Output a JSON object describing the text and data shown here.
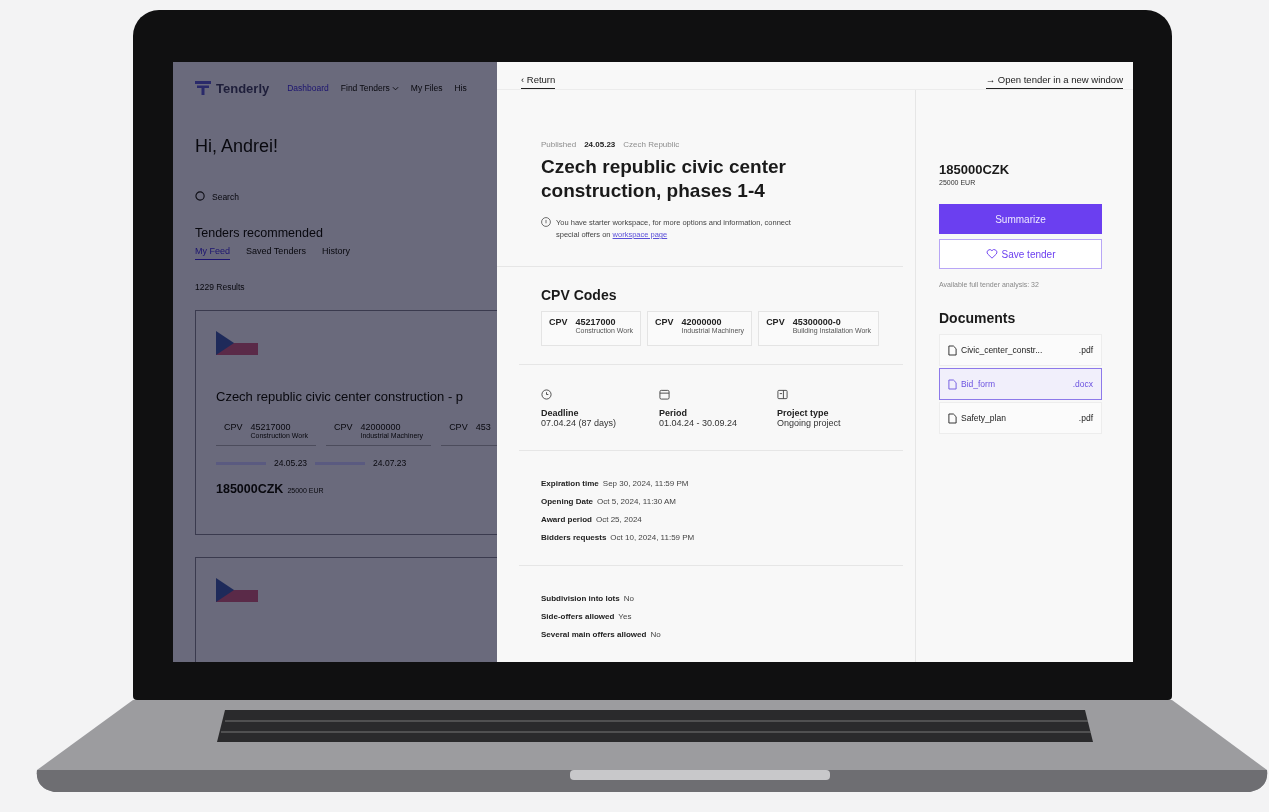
{
  "dashboard": {
    "brand": "Tenderly",
    "nav": [
      {
        "label": "Dashboard",
        "selected": true,
        "has_menu": false
      },
      {
        "label": "Find Tenders",
        "selected": false,
        "has_menu": true
      },
      {
        "label": "My Files",
        "selected": false,
        "has_menu": false
      },
      {
        "label": "His",
        "selected": false,
        "has_menu": false
      }
    ],
    "greeting": "Hi, Andrei!",
    "search": {
      "placeholder": "Search"
    },
    "section_title": "Tenders recommended",
    "tabs": [
      {
        "label": "My Feed",
        "selected": true
      },
      {
        "label": "Saved Tenders",
        "selected": false
      },
      {
        "label": "History",
        "selected": false
      }
    ],
    "results": "1229 Results",
    "cards": [
      {
        "has_flag": true,
        "title": "Czech republic civic center construction - p",
        "cpv": [
          {
            "label": "CPV",
            "code": "45217000",
            "desc": "Construction Work"
          },
          {
            "label": "CPV",
            "code": "42000000",
            "desc": "Industrial Machinery"
          },
          {
            "label": "CPV",
            "code": "453"
          }
        ],
        "dates": [
          "24.05.23",
          "24.07.23"
        ],
        "price": "185000CZK",
        "price_eur": "25000 EUR"
      },
      {
        "has_flag": true
      }
    ]
  },
  "detail": {
    "back": "‹ Return",
    "open_link": "→ Open tender in a new window",
    "published_label": "Published",
    "published_date": "24.05.23",
    "country": "Czech Republic",
    "title": "Czech republic civic center construction, phases 1-4",
    "note": "You have starter workspace, for more options and information, connect special offers on ",
    "note_link": "workspace page",
    "cpv_title": "CPV Codes",
    "cpv": [
      {
        "label": "CPV",
        "code": "45217000",
        "desc": "Construction Work"
      },
      {
        "label": "CPV",
        "code": "42000000",
        "desc": "Industrial Machinery"
      },
      {
        "label": "CPV",
        "code": "45300000-0",
        "desc": "Building Installation Work"
      }
    ],
    "facts": [
      {
        "kind": "clock",
        "label": "Deadline",
        "value": "07.04.24 (87 days)"
      },
      {
        "kind": "calendar",
        "label": "Period",
        "value": "01.04.24 - 30.09.24"
      },
      {
        "kind": "panel",
        "label": "Project type",
        "value": "Ongoing project"
      }
    ],
    "dates": [
      {
        "label": "Expiration time",
        "value": "Sep 30, 2024, 11:59 PM"
      },
      {
        "label": "Opening Date",
        "value": "Oct 5, 2024, 11:30 AM"
      },
      {
        "label": "Award period",
        "value": "Oct 25, 2024"
      },
      {
        "label": "Bidders requests",
        "value": "Oct 10, 2024, 11:59 PM"
      }
    ],
    "lots": [
      {
        "label": "Subdivision into lots",
        "value": "No"
      },
      {
        "label": "Side-offers allowed",
        "value": "Yes"
      },
      {
        "label": "Several main offers allowed",
        "value": "No"
      }
    ],
    "price": "185000CZK",
    "price_eur": "25000 EUR",
    "summarize": "Summarize",
    "save": "Save tender",
    "analysis": "Available full tender analysis: 32",
    "documents_title": "Documents",
    "documents": [
      {
        "name": "Civic_center_constr...",
        "ext": ".pdf",
        "selected": false
      },
      {
        "name": "Bid_form",
        "ext": ".docx",
        "selected": true
      },
      {
        "name": "Safety_plan",
        "ext": ".pdf",
        "selected": false
      }
    ]
  }
}
